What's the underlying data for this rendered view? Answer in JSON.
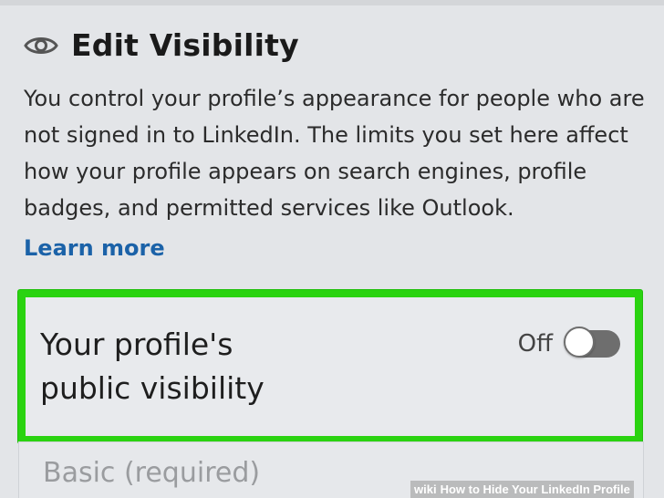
{
  "header": {
    "icon": "eye-icon",
    "title": "Edit Visibility"
  },
  "description": "You control your profile’s appearance for people who are not signed in to LinkedIn. The limits you set here affect how your profile appears on search engines, profile badges, and permitted services like Outlook.",
  "learn_more": "Learn more",
  "visibility_setting": {
    "label": "Your profile's\npublic visibility",
    "state_label": "Off",
    "enabled": false
  },
  "basic_section": {
    "label": "Basic (required)"
  },
  "watermark": {
    "brand": "wiki",
    "text": "How to Hide Your LinkedIn Profile"
  },
  "colors": {
    "background": "#e3e5e8",
    "link": "#1b62a8",
    "highlight_border": "#2ad310",
    "toggle_off": "#6e6e6e"
  }
}
